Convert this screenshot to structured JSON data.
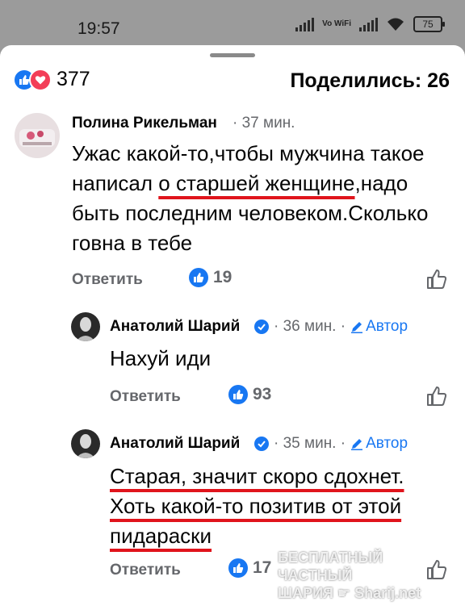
{
  "status_bar": {
    "time": "19:57",
    "network": "Vo WiFi",
    "battery": "75"
  },
  "summary": {
    "reaction_count": "377",
    "shares": "Поделились: 26"
  },
  "comments": [
    {
      "author": "Полина Рикельман",
      "time": "· 37 мин.",
      "text_parts": [
        "Ужас какой-то,чтобы мужчина такое написал ",
        "о старшей женщине",
        ",надо быть последним человеком.Сколько говна в тебе"
      ],
      "reply_label": "Ответить",
      "likes": "19"
    },
    {
      "author": "Анатолий Шарий",
      "time": "· 36 мин. ·",
      "author_badge": "Автор",
      "text": "Нахуй иди",
      "reply_label": "Ответить",
      "likes": "93"
    },
    {
      "author": "Анатолий Шарий",
      "time": "· 35 мин. ·",
      "author_badge": "Автор",
      "text": "Старая, значит скоро сдохнет. Хоть какой-то позитив от этой пидараски",
      "reply_label": "Ответить",
      "likes": "17"
    }
  ],
  "watermark": {
    "line1": "БЕСПЛАТНЫЙ ЧАСТНЫЙ",
    "line2": "ШАРИЯ",
    "line3": "Sharij.net"
  },
  "colors": {
    "like_blue": "#1877f2",
    "love_red": "#f33e58",
    "underline_red": "#e0141c"
  }
}
